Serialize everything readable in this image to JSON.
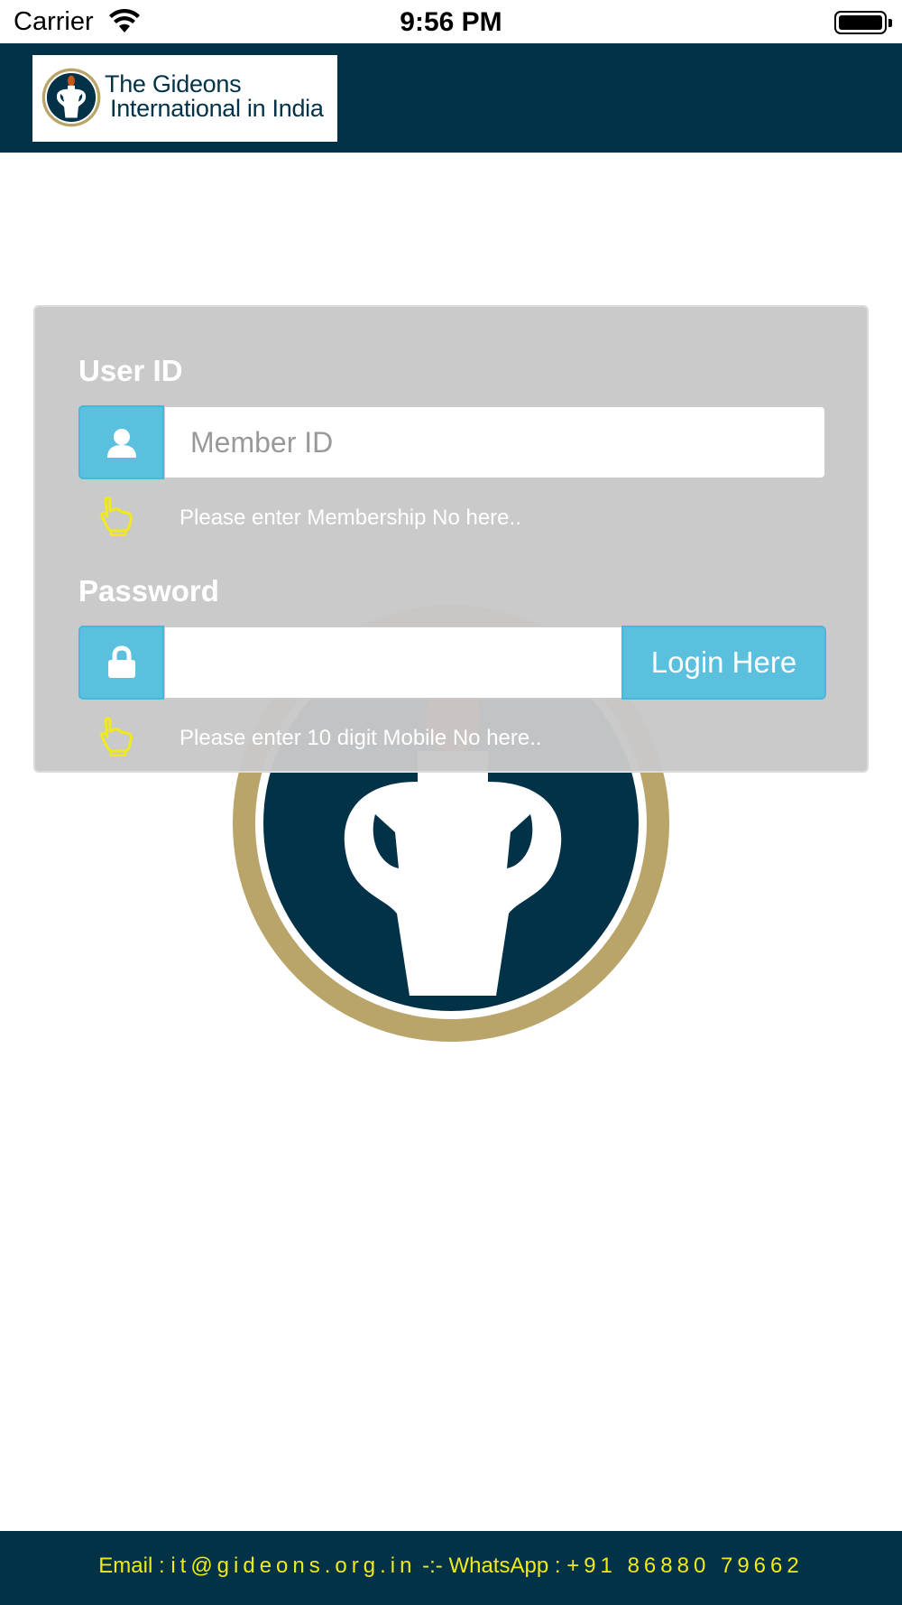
{
  "status_bar": {
    "carrier": "Carrier",
    "time": "9:56 PM"
  },
  "header": {
    "logo_line1": "The Gideons",
    "logo_line2": "International in India"
  },
  "login": {
    "user_label": "User ID",
    "user_placeholder": "Member ID",
    "user_value": "",
    "user_hint": "Please enter Membership No here..",
    "password_label": "Password",
    "password_value": "",
    "password_hint": "Please enter 10 digit Mobile No here..",
    "login_button": "Login Here"
  },
  "footer": {
    "email_label": "Email :",
    "email": "it@gideons.org.in",
    "separator": "-:-",
    "whatsapp_label": "WhatsApp :",
    "whatsapp": "+91 86880 79662"
  },
  "icons": {
    "user": "user-icon",
    "lock": "lock-icon",
    "hint": "pointing-hand-icon",
    "wifi": "wifi-icon",
    "battery": "battery-icon",
    "emblem": "gideons-emblem-icon"
  },
  "colors": {
    "header_bg": "#023247",
    "accent": "#5bc0de",
    "hint_icon": "#f0ea1a",
    "footer_text": "#f0ea1a",
    "emblem_ring": "#b9a46a",
    "flame": "#c8551a"
  }
}
